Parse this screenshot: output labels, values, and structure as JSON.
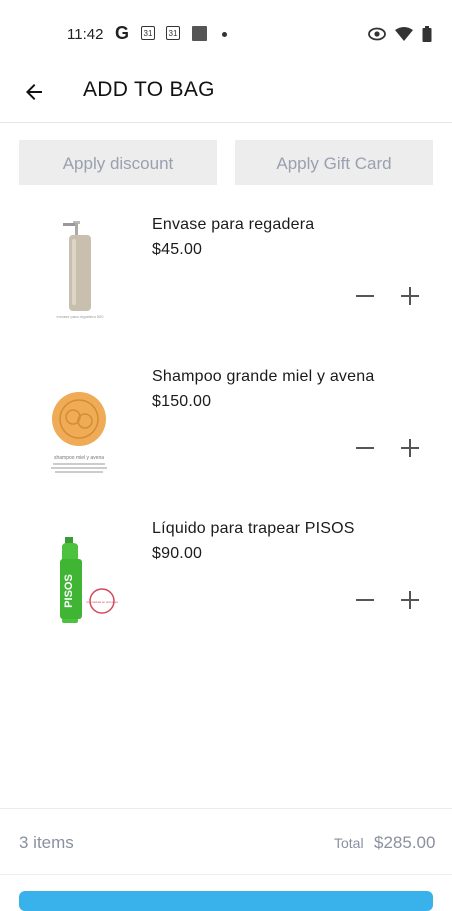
{
  "status_bar": {
    "time": "11:42",
    "g_label": "G",
    "cal1": "31",
    "cal2": "31"
  },
  "app_bar": {
    "title": "ADD TO BAG"
  },
  "actions": {
    "apply_discount": "Apply discount",
    "apply_gift_card": "Apply Gift Card"
  },
  "cart": {
    "items": [
      {
        "name": "Envase para regadera",
        "price": "$45.00",
        "image_caption": "envase para regadera 500",
        "image": "bottle-image"
      },
      {
        "name": "Shampoo grande miel y avena",
        "price": "$150.00",
        "image_caption": "shampoo miel y avena",
        "image": "soap-bar-image"
      },
      {
        "name": "Líquido para trapear PISOS",
        "price": "$90.00",
        "image_label": "PISOS",
        "image_stamp": "no pruebas en animales",
        "image": "green-bottle-image"
      }
    ]
  },
  "summary": {
    "count": "3 items",
    "total_label": "Total",
    "total_value": "$285.00"
  },
  "colors": {
    "accent": "#39b1ea",
    "muted_text": "#8a90a0",
    "button_bg": "#ededed"
  }
}
